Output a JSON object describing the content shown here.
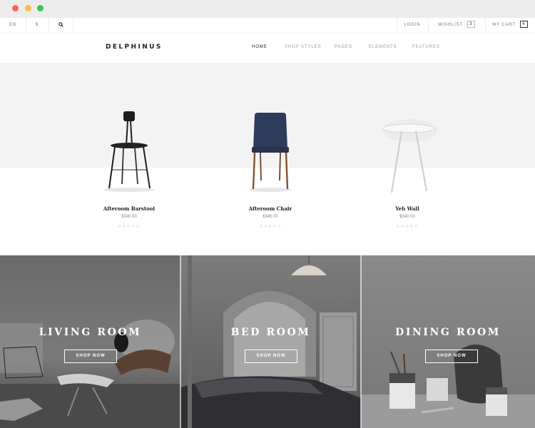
{
  "window": {
    "controls": [
      "close",
      "minimize",
      "maximize"
    ]
  },
  "topbar": {
    "language": "EN",
    "currency": "$",
    "search_icon": "search-icon",
    "login": "LOGIN",
    "wishlist_label": "WISHLIST",
    "wishlist_count": "3",
    "cart_label": "MY CART",
    "cart_count": "4"
  },
  "header": {
    "logo": "DELPHINUS",
    "nav": [
      "HOME",
      "SHOP STYLES",
      "PAGES",
      "ELEMENTS",
      "FEATURES"
    ],
    "active_nav": "HOME"
  },
  "products": [
    {
      "name": "Afteroom Barstool",
      "price": "$340.00",
      "rating": "☆☆☆☆☆"
    },
    {
      "name": "Afteroom Chair",
      "price": "$340.00",
      "rating": "☆☆☆☆☆"
    },
    {
      "name": "Yeh Wall",
      "price": "$340.00",
      "rating": "☆☆☆☆☆"
    }
  ],
  "categories": [
    {
      "title": "LIVING ROOM",
      "button": "SHOP NOW"
    },
    {
      "title": "BED ROOM",
      "button": "SHOP NOW"
    },
    {
      "title": "DINING ROOM",
      "button": "SHOP NOW"
    }
  ],
  "colors": {
    "accent_rating": "#6ec3e8",
    "chair_blue": "#2e3c5c",
    "chair_wood": "#8a4f2a"
  }
}
